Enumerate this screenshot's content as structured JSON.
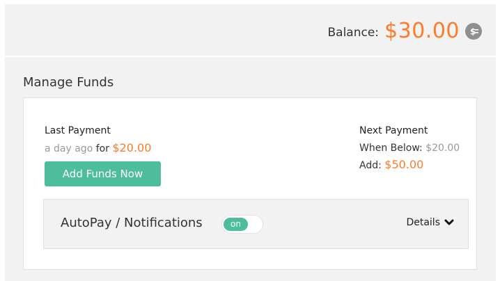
{
  "balance": {
    "label": "Balance:",
    "amount": "$30.00",
    "icon": "coin-dollar-icon"
  },
  "manage_funds": {
    "title": "Manage Funds",
    "last_payment": {
      "title": "Last Payment",
      "when": "a day ago",
      "connector": "for",
      "amount": "$20.00"
    },
    "add_funds_label": "Add Funds Now",
    "next_payment": {
      "title": "Next Payment",
      "when_below_label": "When Below:",
      "when_below_value": "$20.00",
      "add_label": "Add:",
      "add_value": "$50.00"
    },
    "autopay": {
      "label": "AutoPay / Notifications",
      "toggle_state": "on",
      "details_label": "Details",
      "details_icon": "chevron-down-icon"
    }
  },
  "colors": {
    "accent_orange": "#ff7a2b",
    "accent_green": "#4dbd9b",
    "panel_bg": "#f2f2f2"
  }
}
